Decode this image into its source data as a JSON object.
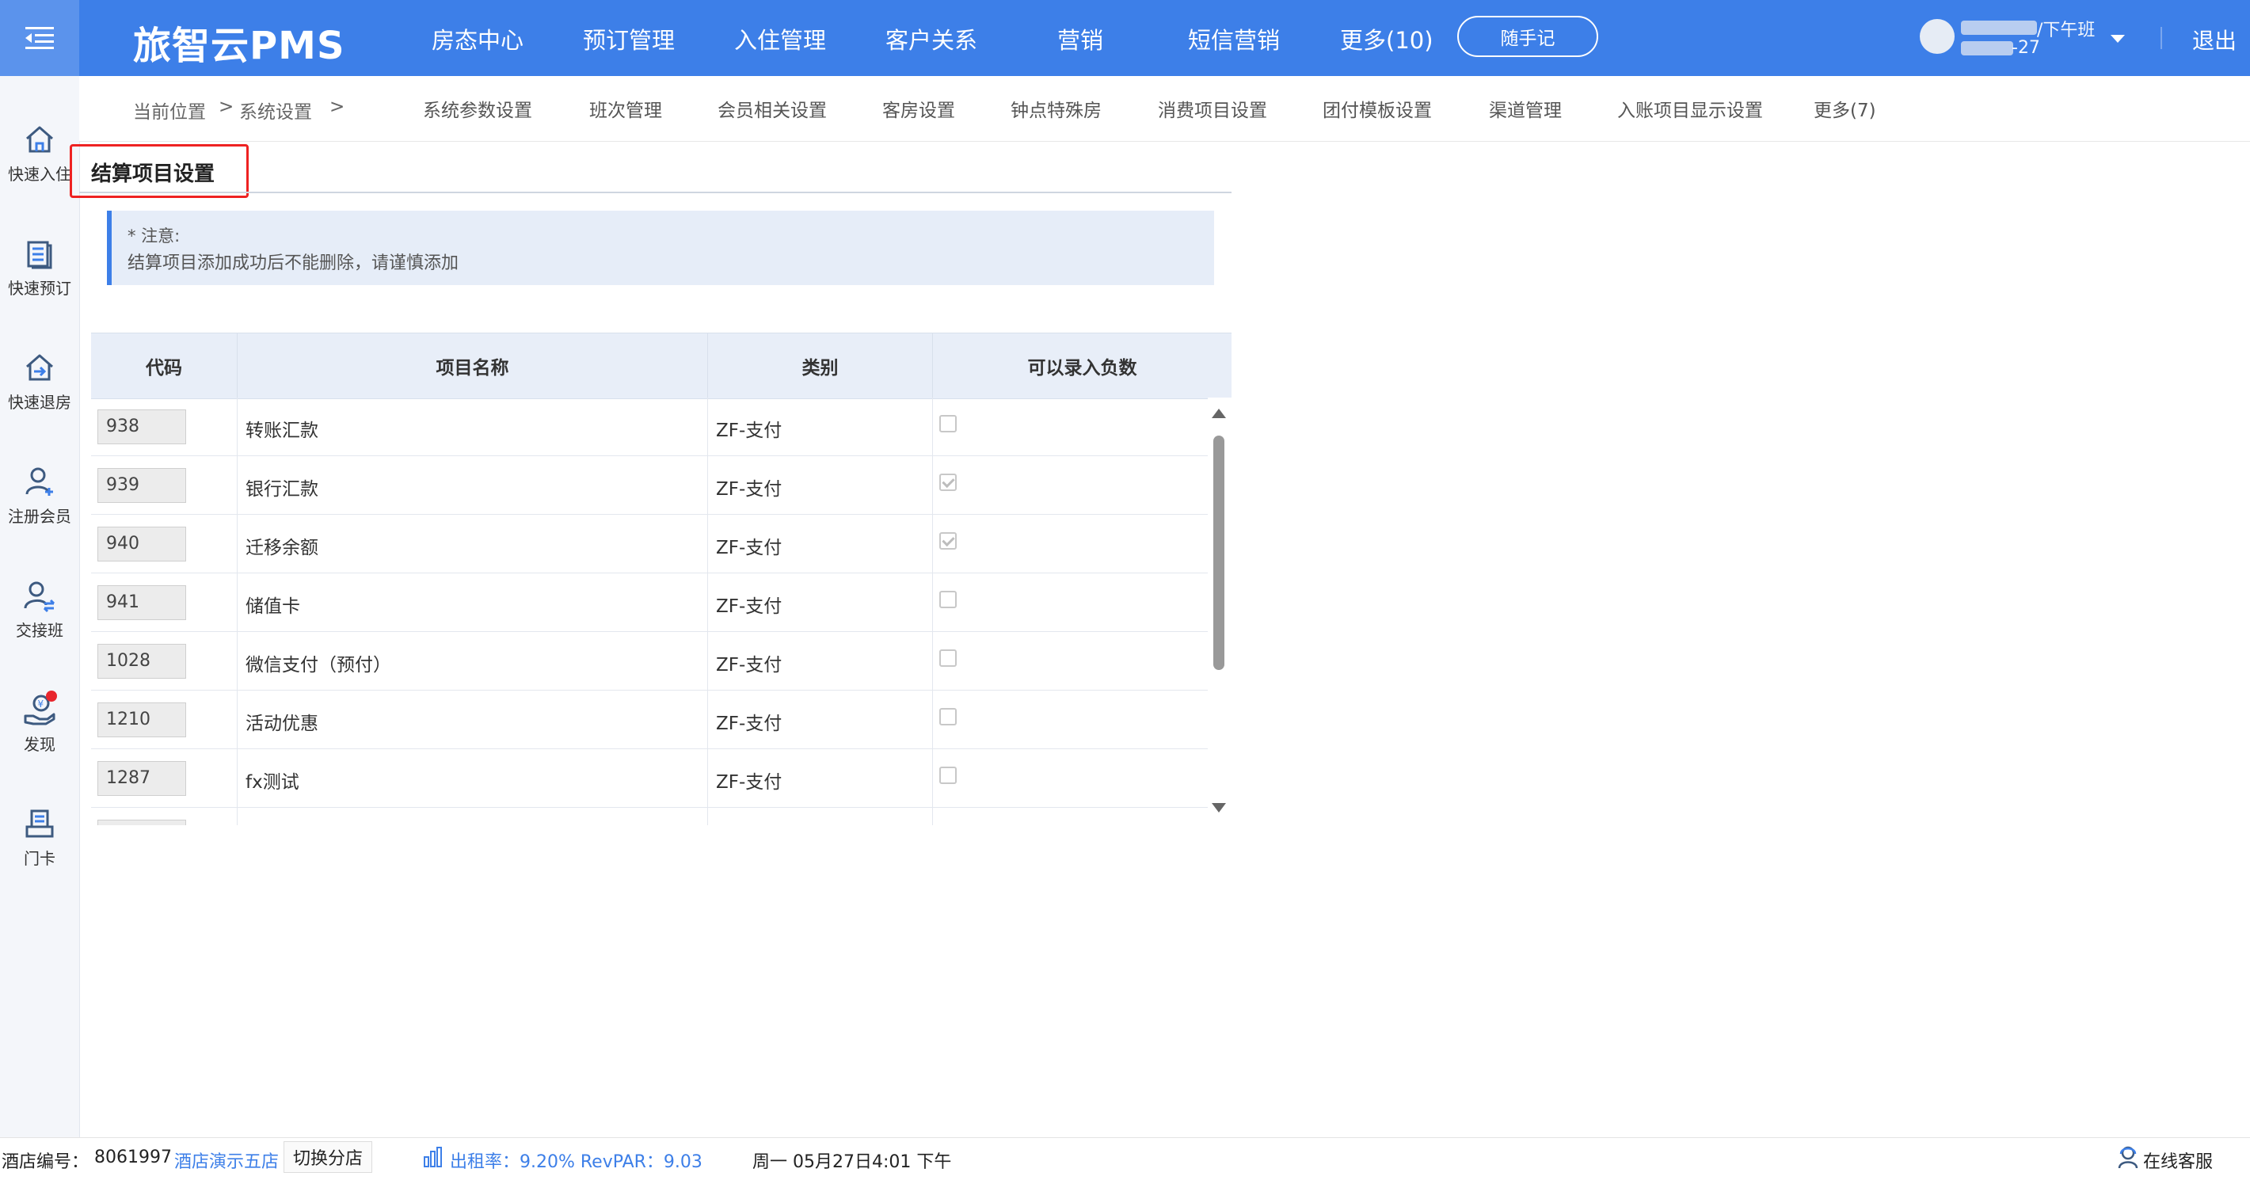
{
  "header": {
    "brand": "旅智云PMS",
    "nav": [
      "房态中心",
      "预订管理",
      "入住管理",
      "客户关系",
      "营销",
      "短信营销",
      "更多(10)"
    ],
    "memo_button": "随手记",
    "user_shift": "/下午班",
    "user_date": "-27",
    "logout": "退出"
  },
  "sidebar": {
    "items": [
      {
        "label": "快速入住",
        "icon": "home-icon"
      },
      {
        "label": "快速预订",
        "icon": "booking-list-icon"
      },
      {
        "label": "快速退房",
        "icon": "checkout-house-icon"
      },
      {
        "label": "注册会员",
        "icon": "add-member-icon"
      },
      {
        "label": "交接班",
        "icon": "shift-handover-icon"
      },
      {
        "label": "发现",
        "icon": "discover-hand-icon"
      },
      {
        "label": "门卡",
        "icon": "door-card-icon"
      }
    ]
  },
  "breadcrumb": {
    "label": "当前位置",
    "sep1": ">",
    "current": "系统设置",
    "sep2": ">"
  },
  "subtabs": [
    "系统参数设置",
    "班次管理",
    "会员相关设置",
    "客房设置",
    "钟点特殊房",
    "消费项目设置",
    "团付模板设置",
    "渠道管理",
    "入账项目显示设置",
    "更多(7)"
  ],
  "page": {
    "title": "结算项目设置",
    "notice_title": "* 注意:",
    "notice_text": "结算项目添加成功后不能删除，请谨慎添加"
  },
  "table": {
    "headers": [
      "代码",
      "项目名称",
      "类别",
      "可以录入负数"
    ],
    "rows": [
      {
        "code": "938",
        "name": "转账汇款",
        "category": "ZF-支付",
        "negative": false
      },
      {
        "code": "939",
        "name": "银行汇款",
        "category": "ZF-支付",
        "negative": true
      },
      {
        "code": "940",
        "name": "迁移余额",
        "category": "ZF-支付",
        "negative": true
      },
      {
        "code": "941",
        "name": "储值卡",
        "category": "ZF-支付",
        "negative": false
      },
      {
        "code": "1028",
        "name": "微信支付（预付）",
        "category": "ZF-支付",
        "negative": false
      },
      {
        "code": "1210",
        "name": "活动优惠",
        "category": "ZF-支付",
        "negative": false
      },
      {
        "code": "1287",
        "name": "fx测试",
        "category": "ZF-支付",
        "negative": false
      }
    ]
  },
  "footer": {
    "hotel_id_label": "酒店编号：",
    "hotel_id": "8061997",
    "hotel_name": "酒店演示五店",
    "switch_store": "切换分店",
    "occupancy": "出租率：9.20% RevPAR：9.03",
    "datetime": "周一 05月27日4:01 下午",
    "online_service": "在线客服"
  },
  "colors": {
    "primary": "#3d7fe8",
    "highlight_border": "#e22222",
    "table_header_bg": "#e8eef8",
    "notice_bg": "#e6edf8"
  }
}
